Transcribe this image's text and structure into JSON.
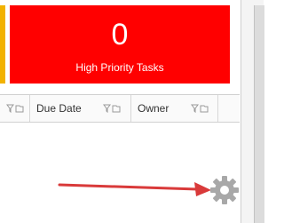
{
  "tile": {
    "count": "0",
    "label": "High Priority Tasks",
    "color": "#ff0000"
  },
  "grid": {
    "columns": [
      {
        "label": ""
      },
      {
        "label": "Due Date"
      },
      {
        "label": "Owner"
      }
    ]
  },
  "icons": {
    "filter": "filter-icon",
    "folder": "folder-icon",
    "settings": "gear-icon"
  },
  "annotation": {
    "arrow_color": "#d93a3a"
  }
}
